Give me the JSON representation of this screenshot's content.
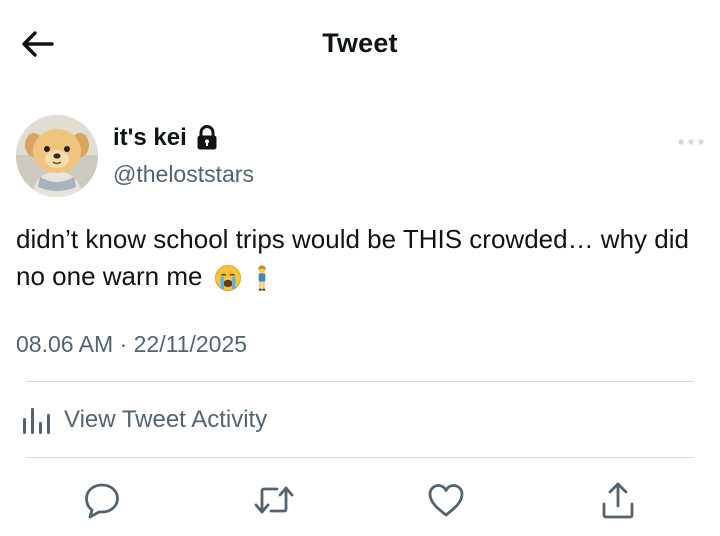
{
  "header": {
    "title": "Tweet",
    "back_icon": "arrow-left-icon"
  },
  "author": {
    "display_name": "it's kei",
    "handle": "@theloststars",
    "protected": true,
    "lock_icon": "lock-icon"
  },
  "tweet": {
    "text": "didn’t know school trips would be THIS crowded… why did no one warn me",
    "emojis": [
      "loudly-crying-face",
      "standing-woman"
    ],
    "timestamp": "08.06 AM · 22/11/2025"
  },
  "activity": {
    "label": "View Tweet Activity",
    "icon": "bar-chart-icon"
  },
  "actions": [
    {
      "name": "reply",
      "icon": "comment-icon"
    },
    {
      "name": "retweet",
      "icon": "retweet-icon"
    },
    {
      "name": "like",
      "icon": "heart-icon"
    },
    {
      "name": "share",
      "icon": "share-icon"
    }
  ],
  "colors": {
    "text_primary": "#0f1419",
    "text_secondary": "#536471",
    "divider": "#cfd9de"
  }
}
